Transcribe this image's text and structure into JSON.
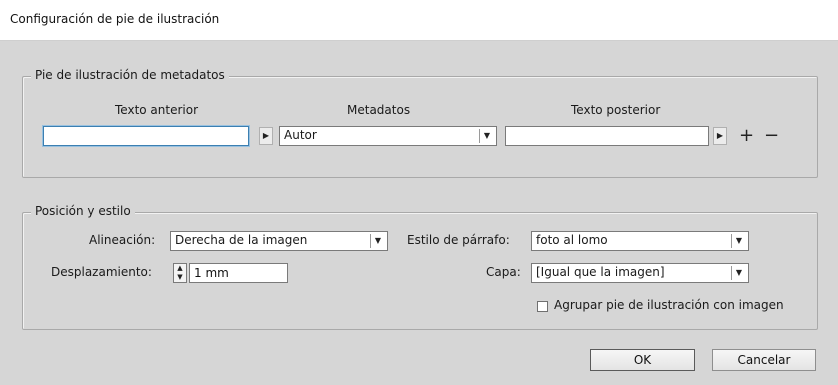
{
  "window": {
    "title": "Configuración de pie de ilustración"
  },
  "metadata_group": {
    "legend": "Pie de ilustración de metadatos",
    "col_before": "Texto anterior",
    "col_metadata": "Metadatos",
    "col_after": "Texto posterior",
    "before_value": "",
    "metadata_value": "Autor",
    "after_value": "",
    "add_symbol": "+",
    "remove_symbol": "−"
  },
  "position_group": {
    "legend": "Posición y estilo",
    "alignment_label": "Alineación:",
    "alignment_value": "Derecha de la imagen",
    "offset_label": "Desplazamiento:",
    "offset_value": "1 mm",
    "para_style_label": "Estilo de párrafo:",
    "para_style_value": "foto al lomo",
    "layer_label": "Capa:",
    "layer_value": "[Igual que la imagen]",
    "group_checkbox_label": "Agrupar pie de ilustración con imagen",
    "group_checked": false
  },
  "buttons": {
    "ok": "OK",
    "cancel": "Cancelar"
  },
  "icons": {
    "dropdown": "chevron-down-icon",
    "insert": "triangle-right-icon",
    "stepper": "up-down-stepper-icon"
  }
}
